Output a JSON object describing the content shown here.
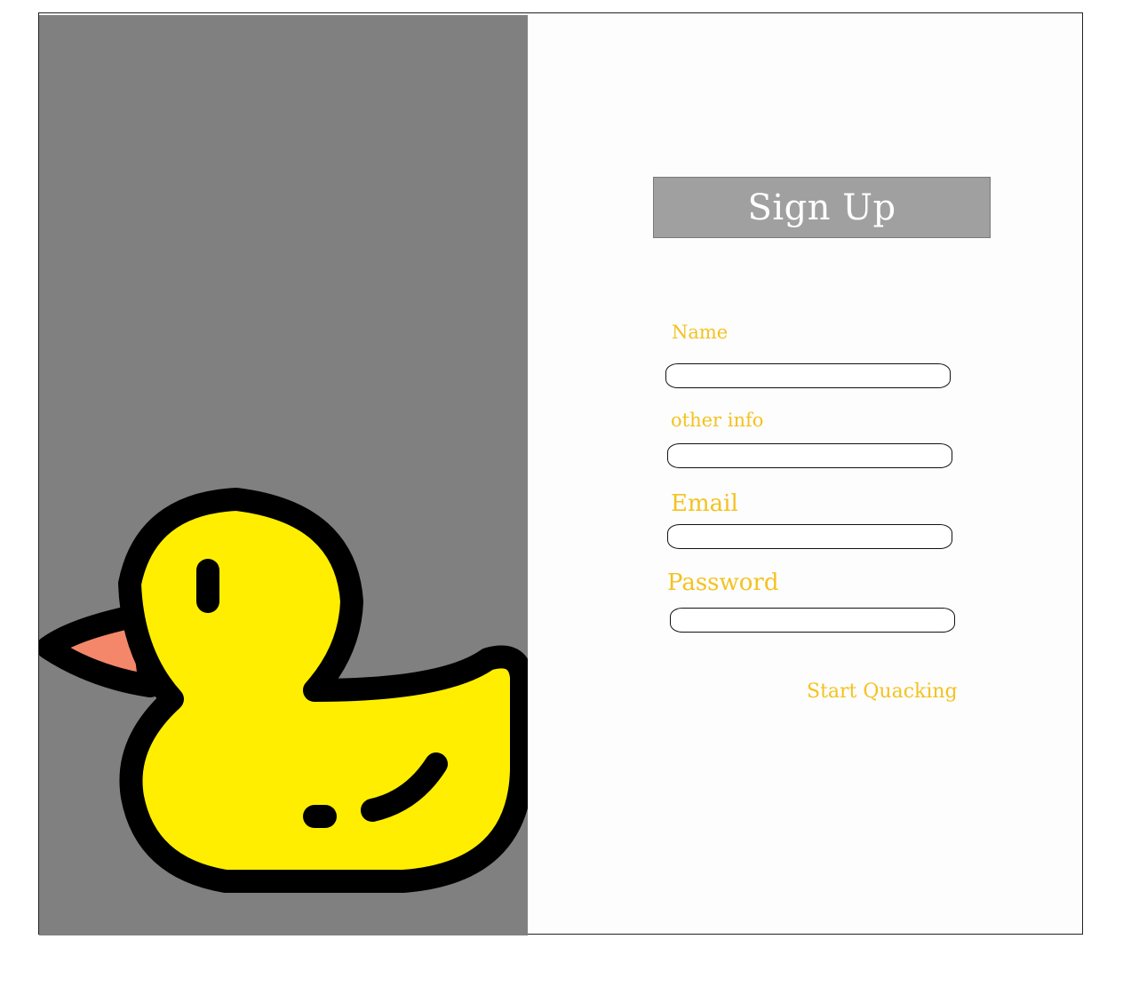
{
  "form": {
    "title": "Sign Up",
    "fields": [
      {
        "label": "Name",
        "value": ""
      },
      {
        "label": "other info",
        "value": ""
      },
      {
        "label": "Email",
        "value": ""
      },
      {
        "label": "Password",
        "value": ""
      }
    ],
    "submit_label": "Start Quacking"
  },
  "illustration": {
    "icon": "duck-icon"
  },
  "colors": {
    "panel_background": "#808080",
    "title_background": "#a0a0a0",
    "label_color": "#f4c220",
    "duck_body": "#ffee00",
    "duck_beak": "#f4876a",
    "duck_outline": "#000000"
  }
}
